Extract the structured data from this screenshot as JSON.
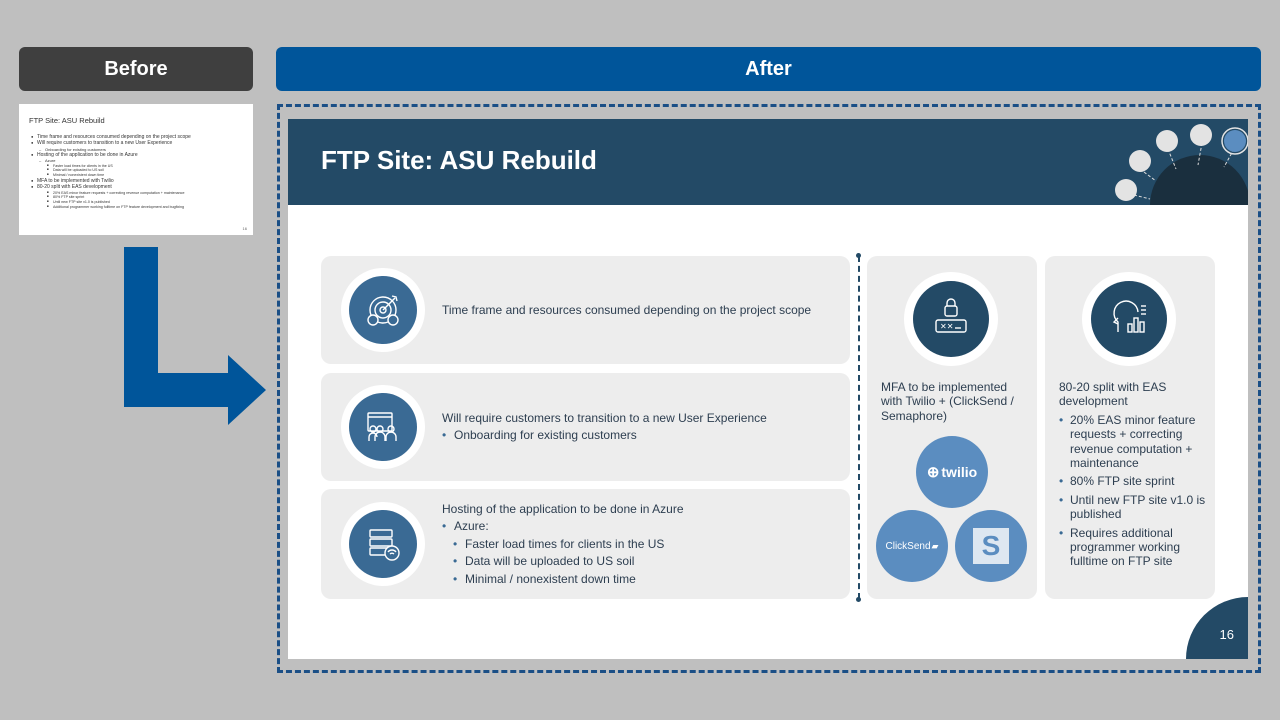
{
  "labels": {
    "before": "Before",
    "after": "After"
  },
  "thumb": {
    "title": "FTP Site: ASU Rebuild",
    "lines": [
      {
        "level": 1,
        "text": "Time frame and resources consumed depending on the project scope"
      },
      {
        "level": 1,
        "text": "Will require customers to transition to a new User Experience"
      },
      {
        "level": 2,
        "text": "Onboarding for existing customers"
      },
      {
        "level": 1,
        "text": "Hosting of the application to be done in Azure"
      },
      {
        "level": 2,
        "text": "Azure"
      },
      {
        "level": 3,
        "text": "Faster load times for clients in the US"
      },
      {
        "level": 3,
        "text": "Data will be uploaded to US soil"
      },
      {
        "level": 3,
        "text": "Minimal / nonexistent down time"
      },
      {
        "level": 1,
        "text": "MFA to be implemented with Twilio"
      },
      {
        "level": 1,
        "text": "80-20 split with EAS development"
      },
      {
        "level": 3,
        "text": "20% EAS minor feature requests + correcting revenue computation + maintenance"
      },
      {
        "level": 3,
        "text": "80% FTP site sprint"
      },
      {
        "level": 3,
        "text": "Until new FTP site v1.0 is published"
      },
      {
        "level": 3,
        "text": "Additional programmer working fulltime on FTP feature development and bugfixing"
      }
    ],
    "page": "16"
  },
  "slide": {
    "title": "FTP Site: ASU Rebuild",
    "page_number": "16",
    "row1": {
      "text": "Time frame and resources consumed depending on the project scope",
      "icon": "target-settings-icon"
    },
    "row2": {
      "text": "Will require customers to transition to a new User Experience",
      "sub": "Onboarding for existing customers",
      "icon": "users-screen-icon"
    },
    "row3": {
      "text": "Hosting of the application to be done in Azure",
      "sub": "Azure:",
      "subsub": [
        "Faster load times for clients in the US",
        "Data will be uploaded to US soil",
        "Minimal / nonexistent down time"
      ],
      "icon": "server-wifi-icon"
    },
    "mfa": {
      "text": "MFA to be implemented with Twilio + (ClickSend / Semaphore)",
      "icon": "lock-password-icon",
      "logos": {
        "twilio": "twilio",
        "clicksend": "ClickSend",
        "semaphore": "S"
      }
    },
    "split": {
      "text": "80-20 split with EAS development",
      "bullets": [
        "20% EAS minor feature requests + correcting revenue computation + maintenance",
        "80% FTP site sprint",
        "Until new FTP site v1.0 is published",
        "Requires additional programmer working fulltime on FTP site"
      ],
      "icon": "head-chart-icon"
    }
  },
  "colors": {
    "header": "#234a66",
    "accent": "#3a6a94",
    "after_bar": "#00559a",
    "arrow": "#00559a"
  }
}
